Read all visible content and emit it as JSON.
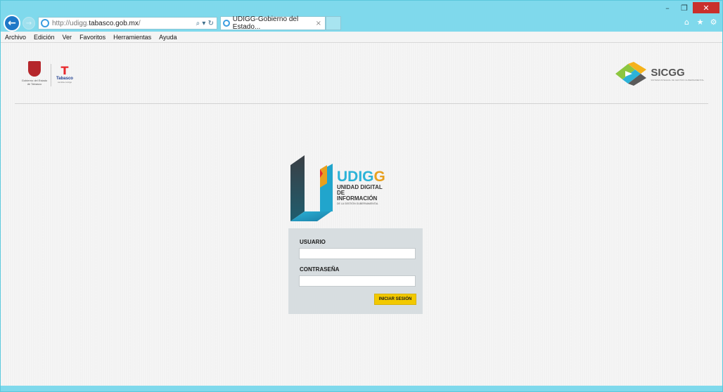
{
  "browser": {
    "address_plain": "http://udigg.",
    "address_bold": "tabasco.gob.mx",
    "address_tail": "/",
    "address_tools": "⌕ ▾ ↻",
    "tab_title": "UDIGG-Gobierno del Estado...",
    "tab_close": "×",
    "back_glyph": "←",
    "forward_glyph": "→",
    "window_controls": {
      "minimize": "–",
      "restore": "❐",
      "close": "✕"
    },
    "right_icons": {
      "home": "⌂",
      "favorites": "★",
      "tools": "⚙"
    },
    "icons": [
      "back-arrow-icon",
      "forward-arrow-icon",
      "ie-logo-icon",
      "search-icon",
      "refresh-icon",
      "home-icon",
      "star-icon",
      "gear-icon"
    ]
  },
  "menu": [
    "Archivo",
    "Edición",
    "Ver",
    "Favoritos",
    "Herramientas",
    "Ayuda"
  ],
  "header": {
    "gov_caption": "Gobierno del Estado de Tabasco",
    "tabasco_letter": "T",
    "tabasco_word": "Tabasco",
    "tabasco_sub": "cambia contigo",
    "sicgg_word": "SICGG",
    "sicgg_sub": "SISTEMA INTEGRAL DE GESTION GUBERNAMENTAL"
  },
  "logo": {
    "udigg_main": "UDIG",
    "udigg_last": "G",
    "line1": "UNIDAD DIGITAL",
    "line2": "DE INFORMACIÓN",
    "line3": "DE LA GESTIÓN GUBERNAMENTAL"
  },
  "login": {
    "user_label": "USUARIO",
    "user_value": "",
    "password_label": "CONTRASEÑA",
    "password_value": "",
    "submit_label": "INICIAR SESIÓN"
  },
  "colors": {
    "browser_chrome": "#7fd9ec",
    "udigg_blue": "#2cb3d8",
    "udigg_orange": "#e8a01e",
    "button_yellow": "#f2c900",
    "panel_gray": "#d7dde0"
  }
}
